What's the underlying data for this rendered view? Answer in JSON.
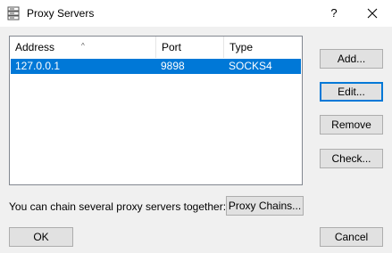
{
  "window": {
    "title": "Proxy Servers",
    "help_label": "?"
  },
  "table": {
    "columns": [
      "Address",
      "Port",
      "Type"
    ],
    "rows": [
      {
        "address": "127.0.0.1",
        "port": "9898",
        "type": "SOCKS4"
      }
    ]
  },
  "buttons": {
    "add": "Add...",
    "edit": "Edit...",
    "remove": "Remove",
    "check": "Check...",
    "proxy_chains": "Proxy Chains...",
    "ok": "OK",
    "cancel": "Cancel"
  },
  "chain_label": "You can chain several proxy servers together:",
  "colors": {
    "selection": "#0078d7",
    "background": "#f0f0f0"
  }
}
